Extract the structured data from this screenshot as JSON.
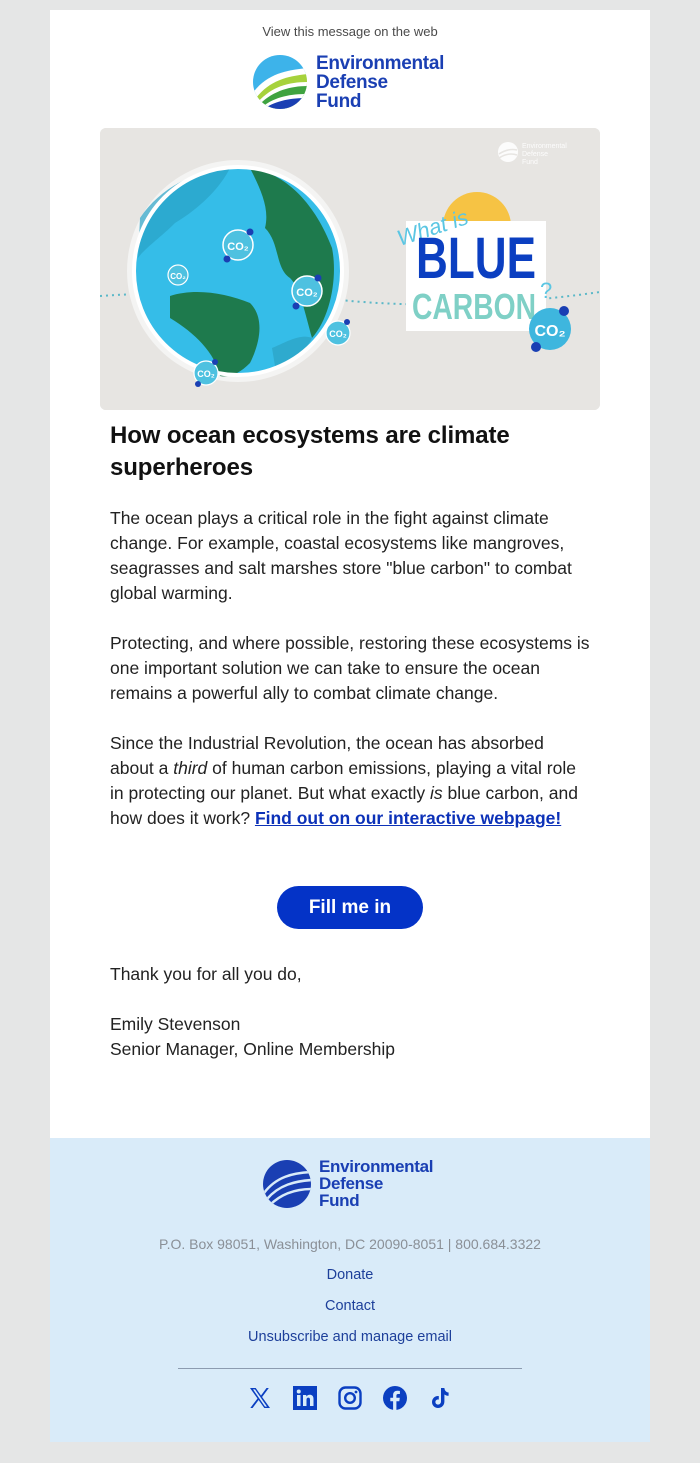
{
  "header": {
    "view_web_link": "View this message on the web",
    "logo": {
      "line1": "Environmental",
      "line2": "Defense",
      "line3": "Fund"
    }
  },
  "hero_image": {
    "alt": "What is Blue Carbon? — globe with CO2 molecules",
    "text_what_is": "What is",
    "text_blue": "BLUE",
    "text_carbon": "CARBON",
    "text_question": "?",
    "co2_label": "CO₂",
    "watermark": "Environmental Defense Fund"
  },
  "article": {
    "headline": "How ocean ecosystems are climate superheroes",
    "paragraph1": "The ocean plays a critical role in the fight against climate change. For example, coastal ecosystems like mangroves, seagrasses and salt marshes store \"blue carbon\" to combat global warming.",
    "paragraph2": "Protecting, and where possible, restoring these ecosystems is one important solution we can take to ensure the ocean remains a powerful ally to combat climate change.",
    "paragraph3": {
      "part1": "Since the Industrial Revolution, the ocean has absorbed about a ",
      "em1": "third",
      "part2": " of human carbon emissions, playing a vital role in protecting our planet. But what exactly ",
      "em2": "is",
      "part3": " blue carbon, and how does it work? ",
      "link": "Find out on our interactive webpage!"
    },
    "cta_label": "Fill me in"
  },
  "signoff": {
    "closing": "Thank you for all you do,",
    "name": "Emily Stevenson",
    "title": "Senior Manager, Online Membership"
  },
  "footer": {
    "logo": {
      "line1": "Environmental",
      "line2": "Defense",
      "line3": "Fund"
    },
    "address": "P.O. Box 98051, Washington, DC 20090-8051 | 800.684.3322",
    "links": [
      "Donate",
      "Contact",
      "Unsubscribe and manage email"
    ],
    "socials": [
      "x-icon",
      "linkedin-icon",
      "instagram-icon",
      "facebook-icon",
      "tiktok-icon"
    ]
  },
  "colors": {
    "brand_blue": "#0433c7",
    "link_blue": "#0c31b8",
    "footer_bg": "#d9ebf9",
    "page_bg": "#e5e6e6"
  }
}
